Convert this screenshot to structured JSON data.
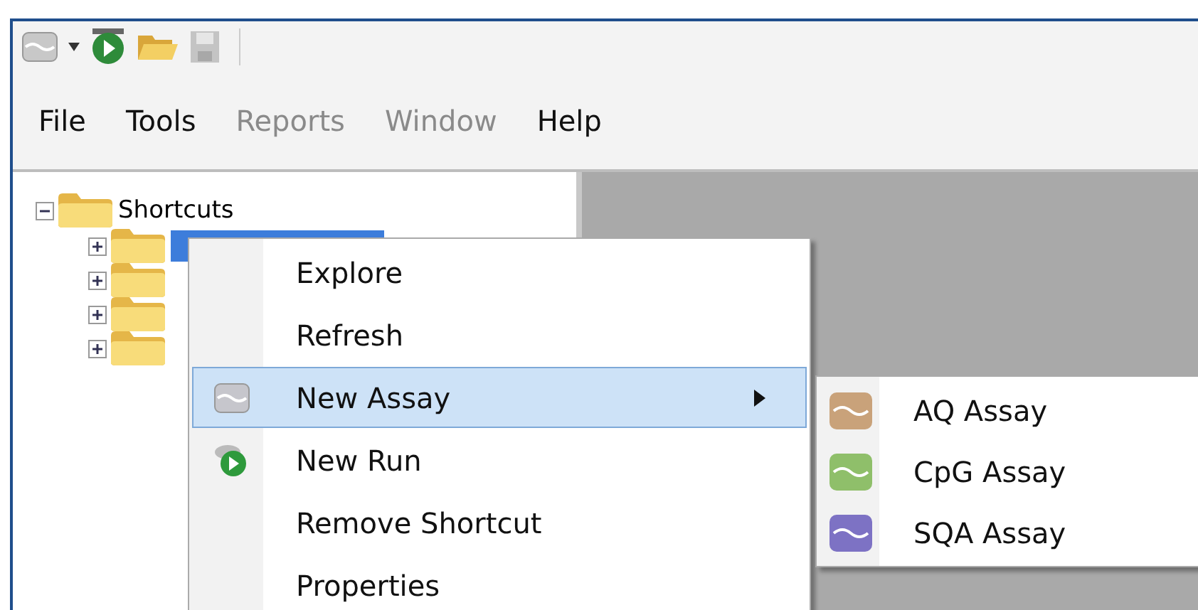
{
  "menubar": [
    {
      "label": "File",
      "disabled": false
    },
    {
      "label": "Tools",
      "disabled": false
    },
    {
      "label": "Reports",
      "disabled": true
    },
    {
      "label": "Window",
      "disabled": true
    },
    {
      "label": "Help",
      "disabled": false
    }
  ],
  "tree": {
    "label": "Shortcuts",
    "expanded": true,
    "children": [
      {
        "expanded": false,
        "selected": true
      },
      {
        "expanded": false,
        "selected": false
      },
      {
        "expanded": false,
        "selected": false
      },
      {
        "expanded": false,
        "selected": false
      }
    ]
  },
  "context_menu": [
    {
      "label": "Explore",
      "kind": "plain",
      "selected": false,
      "has_submenu": false
    },
    {
      "label": "Refresh",
      "kind": "plain",
      "selected": false,
      "has_submenu": false
    },
    {
      "label": "New Assay",
      "kind": "assay",
      "selected": true,
      "has_submenu": true
    },
    {
      "label": "New Run",
      "kind": "run",
      "selected": false,
      "has_submenu": false
    },
    {
      "label": "Remove Shortcut",
      "kind": "plain",
      "selected": false,
      "has_submenu": false
    },
    {
      "label": "Properties",
      "kind": "plain",
      "selected": false,
      "has_submenu": false
    }
  ],
  "submenu": [
    {
      "label": "AQ Assay",
      "color": "#c9a27a"
    },
    {
      "label": "CpG Assay",
      "color": "#8fbf6a"
    },
    {
      "label": "SQA Assay",
      "color": "#7d72c4"
    }
  ]
}
